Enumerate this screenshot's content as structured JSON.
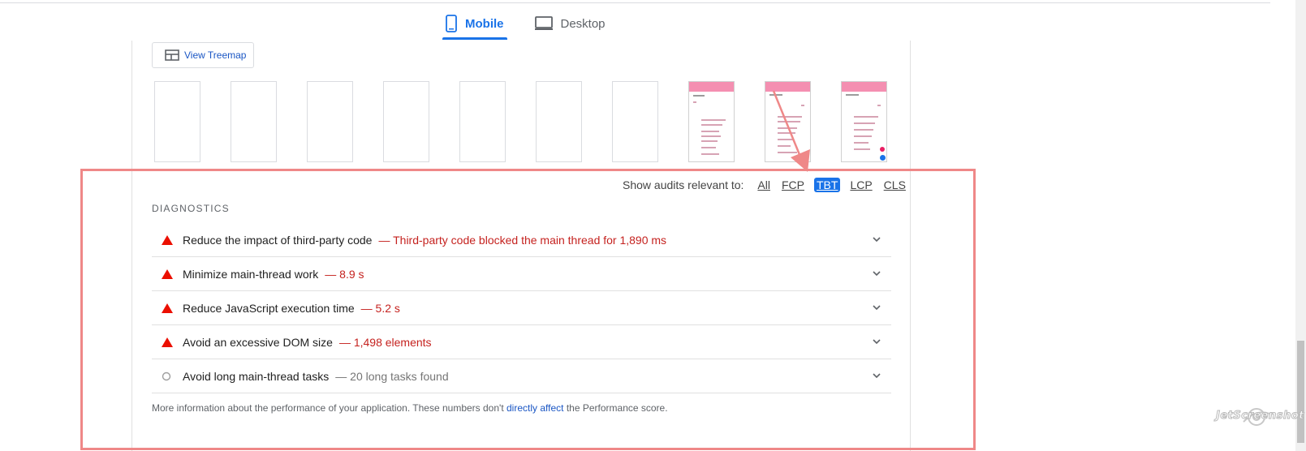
{
  "tabs": [
    {
      "label": "Mobile",
      "icon": "mobile-icon",
      "active": true
    },
    {
      "label": "Desktop",
      "icon": "desktop-icon",
      "active": false
    }
  ],
  "treemap": {
    "label": "View Treemap",
    "icon": "treemap-icon"
  },
  "filmstrip": {
    "frame_count": 10,
    "filled_frames": 3
  },
  "filters": {
    "label": "Show audits relevant to:",
    "options": [
      "All",
      "FCP",
      "TBT",
      "LCP",
      "CLS"
    ],
    "active": "TBT"
  },
  "diagnostics": {
    "title": "DIAGNOSTICS",
    "audits": [
      {
        "status": "fail",
        "title": "Reduce the impact of third-party code",
        "display_value": "— Third-party code blocked the main thread for 1,890 ms"
      },
      {
        "status": "fail",
        "title": "Minimize main-thread work",
        "display_value": "— 8.9 s"
      },
      {
        "status": "fail",
        "title": "Reduce JavaScript execution time",
        "display_value": "— 5.2 s"
      },
      {
        "status": "fail",
        "title": "Avoid an excessive DOM size",
        "display_value": "— 1,498 elements"
      },
      {
        "status": "info",
        "title": "Avoid long main-thread tasks",
        "display_value": "— 20 long tasks found"
      }
    ],
    "footnote_pre": "More information about the performance of your application. These numbers don't",
    "footnote_link": "directly affect",
    "footnote_post": "the Performance score."
  },
  "watermark": "JetScreenshot",
  "colors": {
    "accent": "#1a73e8",
    "fail": "#c5221f",
    "fail_icon": "#eb0f00",
    "highlight": "#ef8888"
  }
}
